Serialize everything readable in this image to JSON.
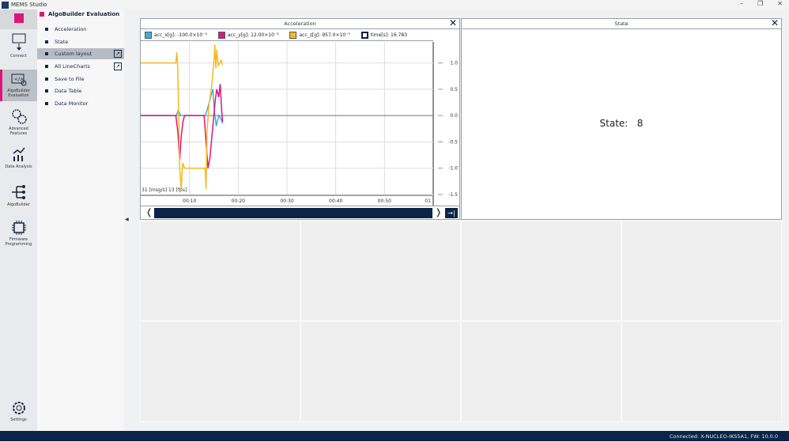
{
  "window": {
    "title": "MEMS Studio",
    "min": "–",
    "max": "❐",
    "close": "✕"
  },
  "rail": [
    {
      "label": "",
      "id": "home"
    },
    {
      "label": "Connect"
    },
    {
      "label": "AlgoBuilder Evaluation"
    },
    {
      "label": "Advanced Features"
    },
    {
      "label": "Data Analysis"
    },
    {
      "label": "AlgoBuilder"
    },
    {
      "label": "Firmware Programming"
    },
    {
      "label": "Settings"
    }
  ],
  "nav": {
    "title": "AlgoBuilder Evaluation",
    "items": [
      {
        "label": "Acceleration"
      },
      {
        "label": "State"
      },
      {
        "label": "Custom layout",
        "selected": true
      },
      {
        "label": "All LineCharts"
      },
      {
        "label": "Save to File"
      },
      {
        "label": "Data Table"
      },
      {
        "label": "Data Monitor"
      }
    ]
  },
  "accel": {
    "title": "Acceleration",
    "fps": "31 [msg/s] 13 [fps]"
  },
  "state": {
    "title": "State",
    "text": "State:   8"
  },
  "status": "Connected:  X-NUCLEO-IKS5A1, FW: 10.0.0",
  "chart_data": {
    "type": "line",
    "title": "Acceleration",
    "legend": [
      {
        "label": "acc_x[g]: -100.0×10⁻³",
        "color": "#3aaee0"
      },
      {
        "label": "acc_y[g]: 12.00×10⁻³",
        "color": "#e0157b"
      },
      {
        "label": "acc_z[g]: 957.0×10⁻³",
        "color": "#f5b921"
      },
      {
        "label": "time[s]: 16.783",
        "color": "#ffffff"
      }
    ],
    "xlim": [
      0,
      60
    ],
    "ylim": [
      -1.5,
      1.4
    ],
    "xticks": [
      {
        "v": 10,
        "label": "00:10"
      },
      {
        "v": 20,
        "label": "00:20"
      },
      {
        "v": 30,
        "label": "00:30"
      },
      {
        "v": 40,
        "label": "00:40"
      },
      {
        "v": 50,
        "label": "00:50"
      },
      {
        "v": 59.5,
        "label": "01"
      }
    ],
    "yticks": [
      {
        "v": 1,
        "label": "1.0"
      },
      {
        "v": 0.5,
        "label": "0.5"
      },
      {
        "v": 0,
        "label": "0.0"
      },
      {
        "v": -0.5,
        "label": "-0.5"
      },
      {
        "v": -1,
        "label": "-1.0"
      },
      {
        "v": -1.5,
        "label": "-1.5"
      }
    ],
    "series": [
      {
        "name": "acc_z",
        "color": "#f5b921",
        "x": [
          0,
          7.2,
          7.4,
          7.6,
          8,
          8.3,
          8.6,
          9,
          13.2,
          13.4,
          13.6,
          14,
          14.6,
          15,
          15.2,
          15.4,
          15.6,
          15.9,
          16.2,
          16.5,
          16.8
        ],
        "y": [
          1,
          1,
          1.2,
          0.9,
          -1,
          -1.4,
          -0.9,
          -1,
          -1,
          -1.4,
          -0.3,
          0.2,
          0.6,
          1.0,
          1.35,
          0.9,
          1.25,
          0.95,
          1.0,
          1.05,
          0.96
        ]
      },
      {
        "name": "acc_y",
        "color": "#e0157b",
        "x": [
          0,
          7.2,
          7.6,
          8,
          8.3,
          8.7,
          9,
          13,
          13.4,
          13.8,
          14.2,
          14.8,
          15.3,
          15.6,
          16,
          16.3,
          16.6,
          16.8
        ],
        "y": [
          0,
          0,
          -0.3,
          -0.85,
          -0.4,
          -0.1,
          0,
          0,
          -0.5,
          -1.0,
          -0.8,
          -0.2,
          0.3,
          0.5,
          0.35,
          0.6,
          0.1,
          -0.12
        ]
      },
      {
        "name": "acc_x",
        "color": "#3aaee0",
        "x": [
          0,
          7.3,
          7.7,
          8.2,
          9,
          13.2,
          13.6,
          14.2,
          14.8,
          15.1,
          15.5,
          16,
          16.4,
          16.8
        ],
        "y": [
          0,
          0,
          0.1,
          0,
          0,
          0,
          0.1,
          0.3,
          0.5,
          0.1,
          -0.2,
          0.0,
          -0.05,
          -0.15
        ]
      },
      {
        "name": "baseline",
        "color": "#7a6fa8",
        "x": [
          0,
          60
        ],
        "y": [
          0,
          0
        ]
      }
    ]
  }
}
